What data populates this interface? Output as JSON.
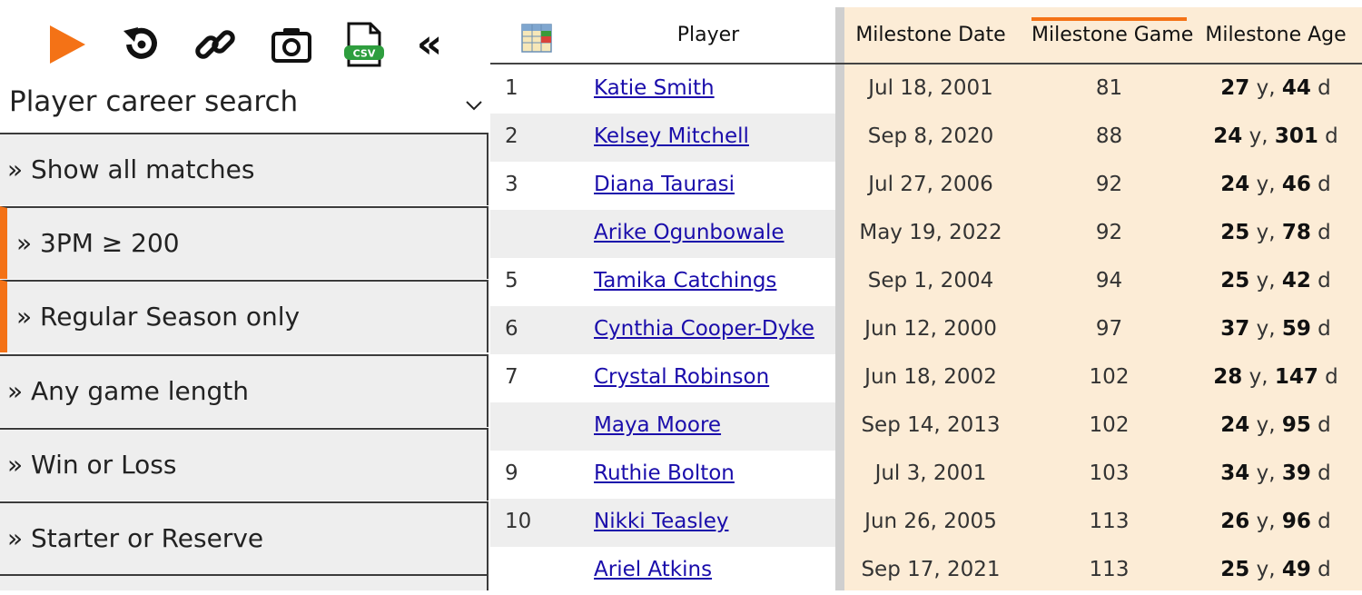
{
  "toolbar": {
    "icons": [
      "play-icon",
      "reset-icon",
      "link-icon",
      "camera-icon",
      "csv-icon",
      "collapse-icon"
    ],
    "csv_label": "CSV",
    "collapse_label": "«",
    "accent": "#f47216"
  },
  "search": {
    "title": "Player career search"
  },
  "filters": [
    {
      "label": "» Show all matches",
      "active": false
    },
    {
      "label": "» 3PM ≥ 200",
      "active": true
    },
    {
      "label": "» Regular Season only",
      "active": true
    },
    {
      "label": "» Any game length",
      "active": false
    },
    {
      "label": "» Win or Loss",
      "active": false
    },
    {
      "label": "» Starter or Reserve",
      "active": false
    }
  ],
  "table": {
    "headers": {
      "player": "Player",
      "milestone_date": "Milestone Date",
      "milestone_game": "Milestone Game",
      "milestone_age": "Milestone Age"
    },
    "sorted_column": "Milestone Game",
    "highlight_color": "#fcecd6",
    "rows": [
      {
        "rank": "1",
        "player": "Katie Smith",
        "date": "Jul 18, 2001",
        "game": "81",
        "age_y": "27",
        "age_d": "44"
      },
      {
        "rank": "2",
        "player": "Kelsey Mitchell",
        "date": "Sep 8, 2020",
        "game": "88",
        "age_y": "24",
        "age_d": "301"
      },
      {
        "rank": "3",
        "player": "Diana Taurasi",
        "date": "Jul 27, 2006",
        "game": "92",
        "age_y": "24",
        "age_d": "46"
      },
      {
        "rank": "",
        "player": "Arike Ogunbowale",
        "date": "May 19, 2022",
        "game": "92",
        "age_y": "25",
        "age_d": "78"
      },
      {
        "rank": "5",
        "player": "Tamika Catchings",
        "date": "Sep 1, 2004",
        "game": "94",
        "age_y": "25",
        "age_d": "42"
      },
      {
        "rank": "6",
        "player": "Cynthia Cooper-Dyke",
        "date": "Jun 12, 2000",
        "game": "97",
        "age_y": "37",
        "age_d": "59"
      },
      {
        "rank": "7",
        "player": "Crystal Robinson",
        "date": "Jun 18, 2002",
        "game": "102",
        "age_y": "28",
        "age_d": "147"
      },
      {
        "rank": "",
        "player": "Maya Moore",
        "date": "Sep 14, 2013",
        "game": "102",
        "age_y": "24",
        "age_d": "95"
      },
      {
        "rank": "9",
        "player": "Ruthie Bolton",
        "date": "Jul 3, 2001",
        "game": "103",
        "age_y": "34",
        "age_d": "39"
      },
      {
        "rank": "10",
        "player": "Nikki Teasley",
        "date": "Jun 26, 2005",
        "game": "113",
        "age_y": "26",
        "age_d": "96"
      },
      {
        "rank": "",
        "player": "Ariel Atkins",
        "date": "Sep 17, 2021",
        "game": "113",
        "age_y": "25",
        "age_d": "49"
      }
    ]
  }
}
